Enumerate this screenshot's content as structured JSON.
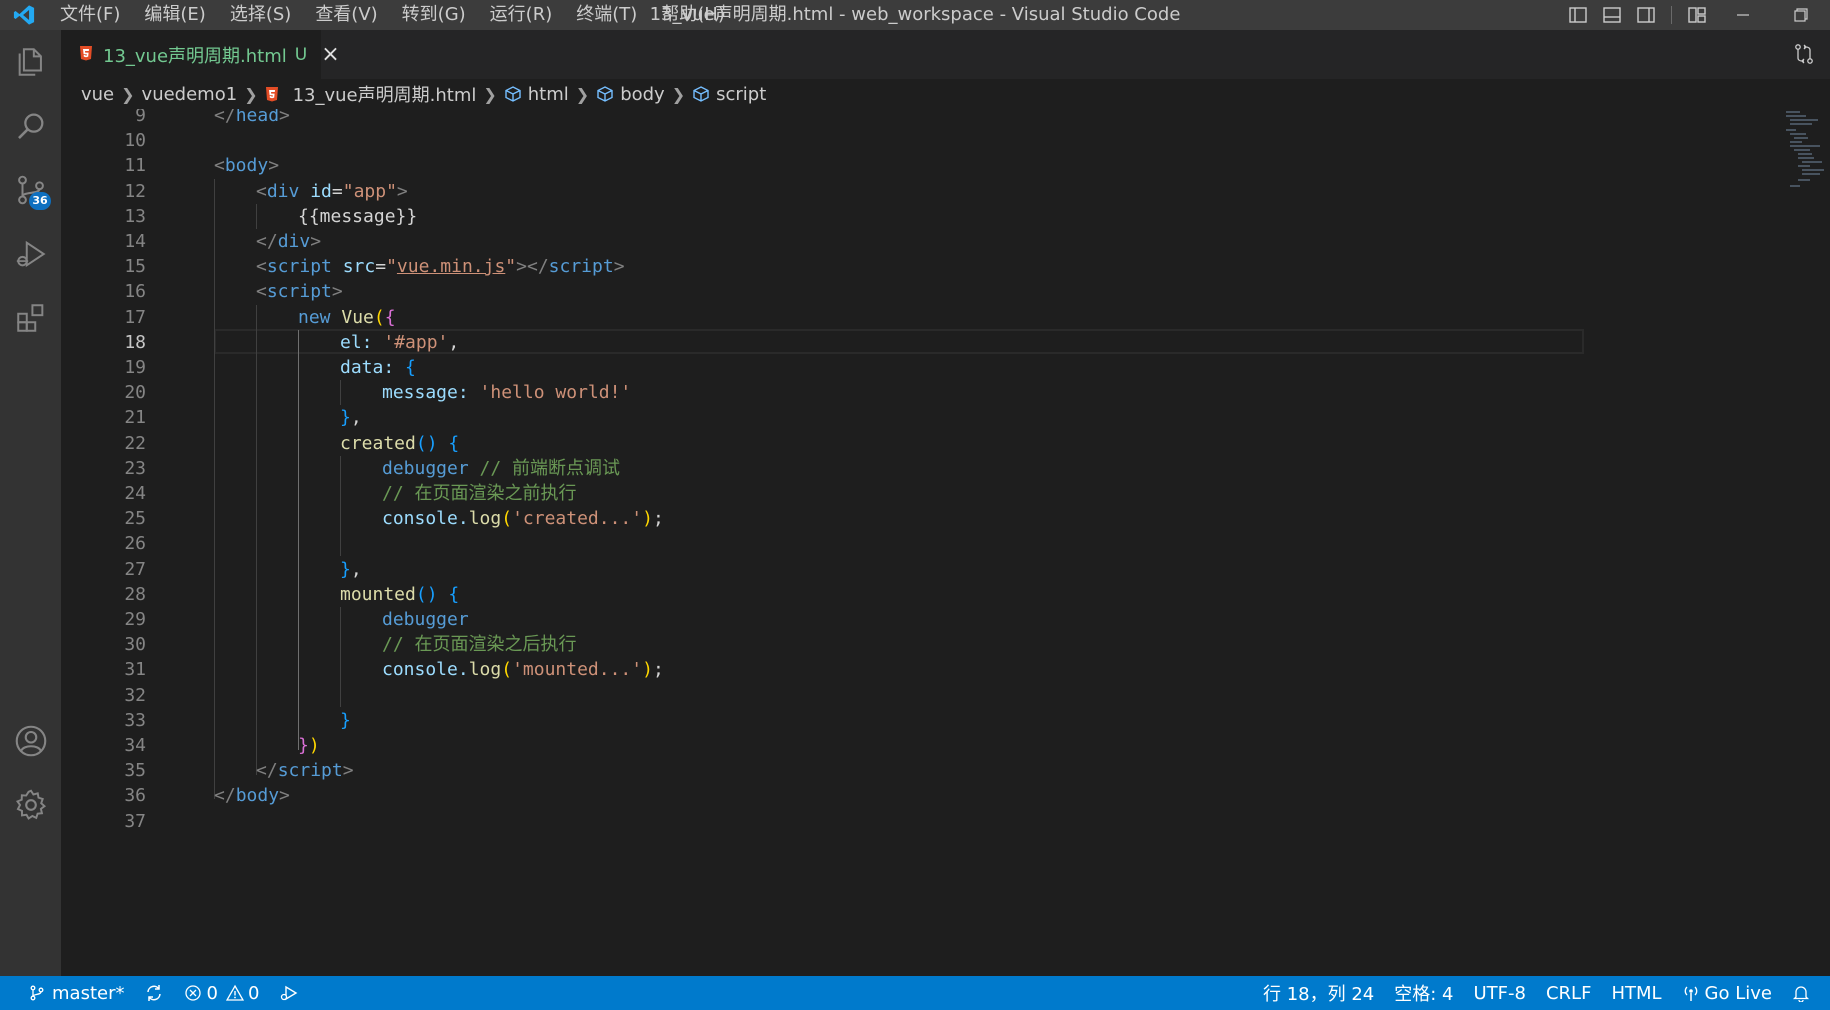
{
  "window": {
    "title": "13_vue声明周期.html - web_workspace - Visual Studio Code",
    "menu": [
      "文件(F)",
      "编辑(E)",
      "选择(S)",
      "查看(V)",
      "转到(G)",
      "运行(R)",
      "终端(T)",
      "帮助(H)"
    ]
  },
  "activity_bar": {
    "source_control_badge": "36",
    "items": [
      "explorer-icon",
      "search-icon",
      "source-control-icon",
      "run-debug-icon",
      "extensions-icon",
      "accounts-icon",
      "manage-gear-icon"
    ]
  },
  "tab": {
    "filename": "13_vue声明周期.html",
    "status": "U",
    "close": "×"
  },
  "breadcrumb": {
    "items": [
      "vue",
      "vuedemo1",
      "13_vue声明周期.html",
      "html",
      "body",
      "script"
    ]
  },
  "editor": {
    "active_line": 18,
    "line_numbers": [
      "9",
      "10",
      "11",
      "12",
      "13",
      "14",
      "15",
      "16",
      "17",
      "18",
      "19",
      "20",
      "21",
      "22",
      "23",
      "24",
      "25",
      "26",
      "27",
      "28",
      "29",
      "30",
      "31",
      "32",
      "33",
      "34",
      "35",
      "36",
      "37"
    ]
  },
  "code": {
    "l9_tag": "head",
    "l11_tag": "body",
    "l12_tag": "div",
    "l12_attr": "id",
    "l12_val": "\"app\"",
    "l13_text": "{{message}}",
    "l14_tag": "div",
    "l15_tag": "script",
    "l15_attr": "src",
    "l15_val": "vue.min.js",
    "l15_close": "script",
    "l16_tag": "script",
    "l17_kw": "new",
    "l17_fn": "Vue",
    "l18_key": "el: ",
    "l18_val": "'#app'",
    "l19_key": "data: ",
    "l20_key": "message: ",
    "l20_val": "'hello world!'",
    "l22_fn": "created",
    "l23_kw": "debugger",
    "l23_cm": "// 前端断点调试",
    "l24_cm": "// 在页面渲染之前执行",
    "l25_obj": "console.",
    "l25_fn": "log",
    "l25_val": "'created...'",
    "l28_fn": "mounted",
    "l29_kw": "debugger",
    "l30_cm": "// 在页面渲染之后执行",
    "l31_obj": "console.",
    "l31_fn": "log",
    "l31_val": "'mounted...'",
    "l35_tag": "script",
    "l36_tag": "body"
  },
  "status_bar": {
    "branch": "master*",
    "errors": "0",
    "warnings": "0",
    "position": "行 18，列 24",
    "spaces": "空格: 4",
    "encoding": "UTF-8",
    "eol": "CRLF",
    "language": "HTML",
    "golive": "Go Live"
  },
  "colors": {
    "statusbar": "#007acc",
    "activitybar": "#333333",
    "editor_bg": "#1e1e1e",
    "untracked": "#73c991"
  }
}
